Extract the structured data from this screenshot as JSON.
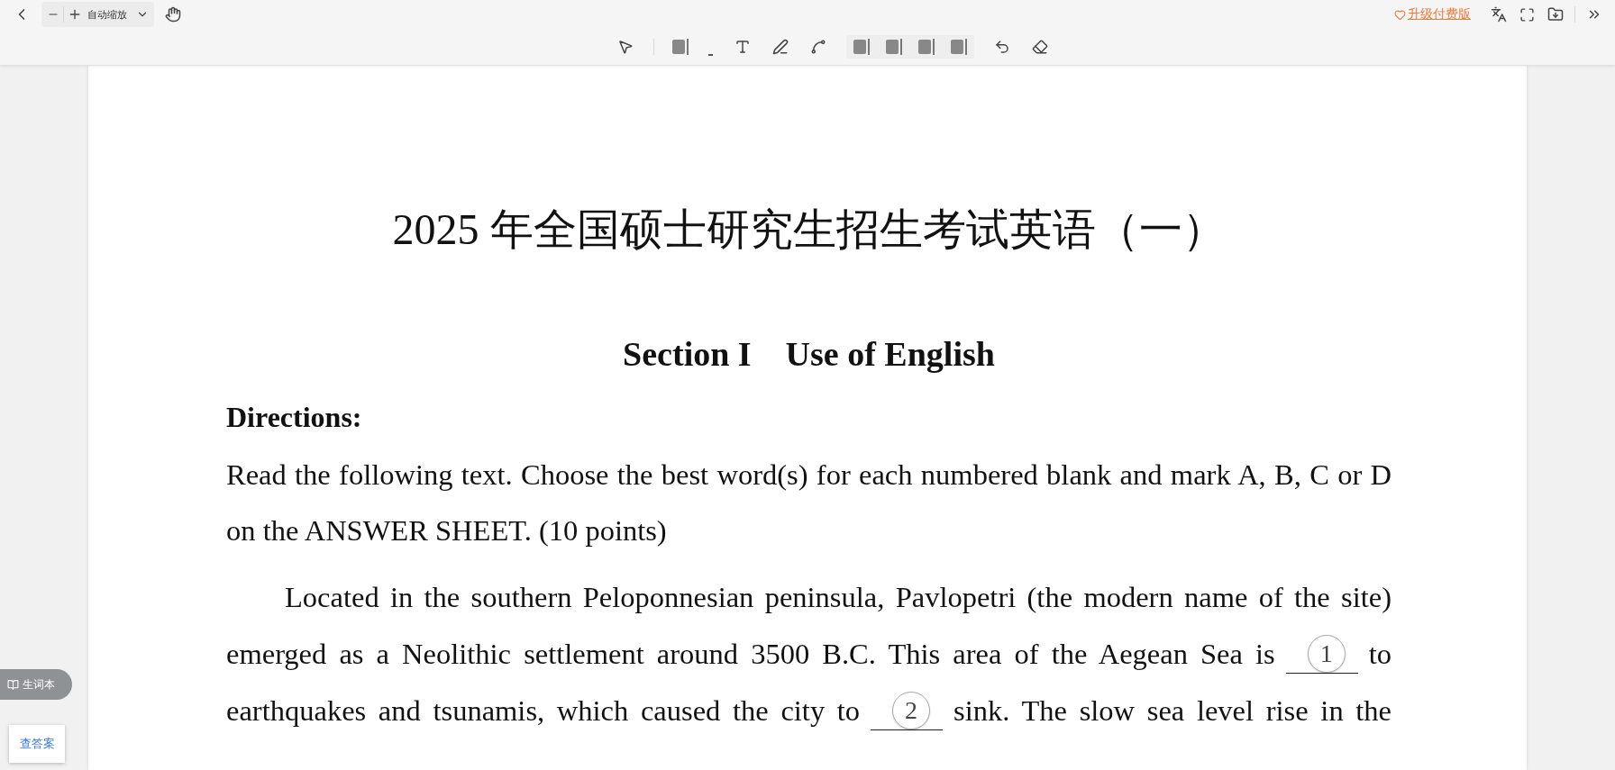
{
  "toolbar": {
    "zoom_label": "自动缩放",
    "upgrade_link": "升级付费版"
  },
  "document": {
    "title": "2025 年全国硕士研究生招生考试英语（一）",
    "section_number": "Section I",
    "section_title": "Use of English",
    "directions_heading": "Directions:",
    "directions": "Read the following text. Choose the best word(s) for each numbered blank and mark A, B, C or D on the ANSWER SHEET. (10 points)",
    "passage_lines": [
      [
        {
          "kind": "text",
          "text": "Located in the southern Peloponnesian peninsula, Pavlopetri (the modern name of the site)"
        }
      ],
      [
        {
          "kind": "text",
          "text": "emerged as a Neolithic settlement around 3500 B.C. This area of the Aegean Sea is"
        },
        {
          "kind": "blank",
          "number": "1"
        },
        {
          "kind": "text",
          "text": "to"
        }
      ],
      [
        {
          "kind": "text",
          "text": "earthquakes and tsunamis, which caused the city to"
        },
        {
          "kind": "blank",
          "number": "2"
        },
        {
          "kind": "text",
          "text": "sink. The slow sea level rise in the"
        }
      ]
    ]
  },
  "side": {
    "vocab_button": "生词本",
    "answer_button": "查答案"
  }
}
